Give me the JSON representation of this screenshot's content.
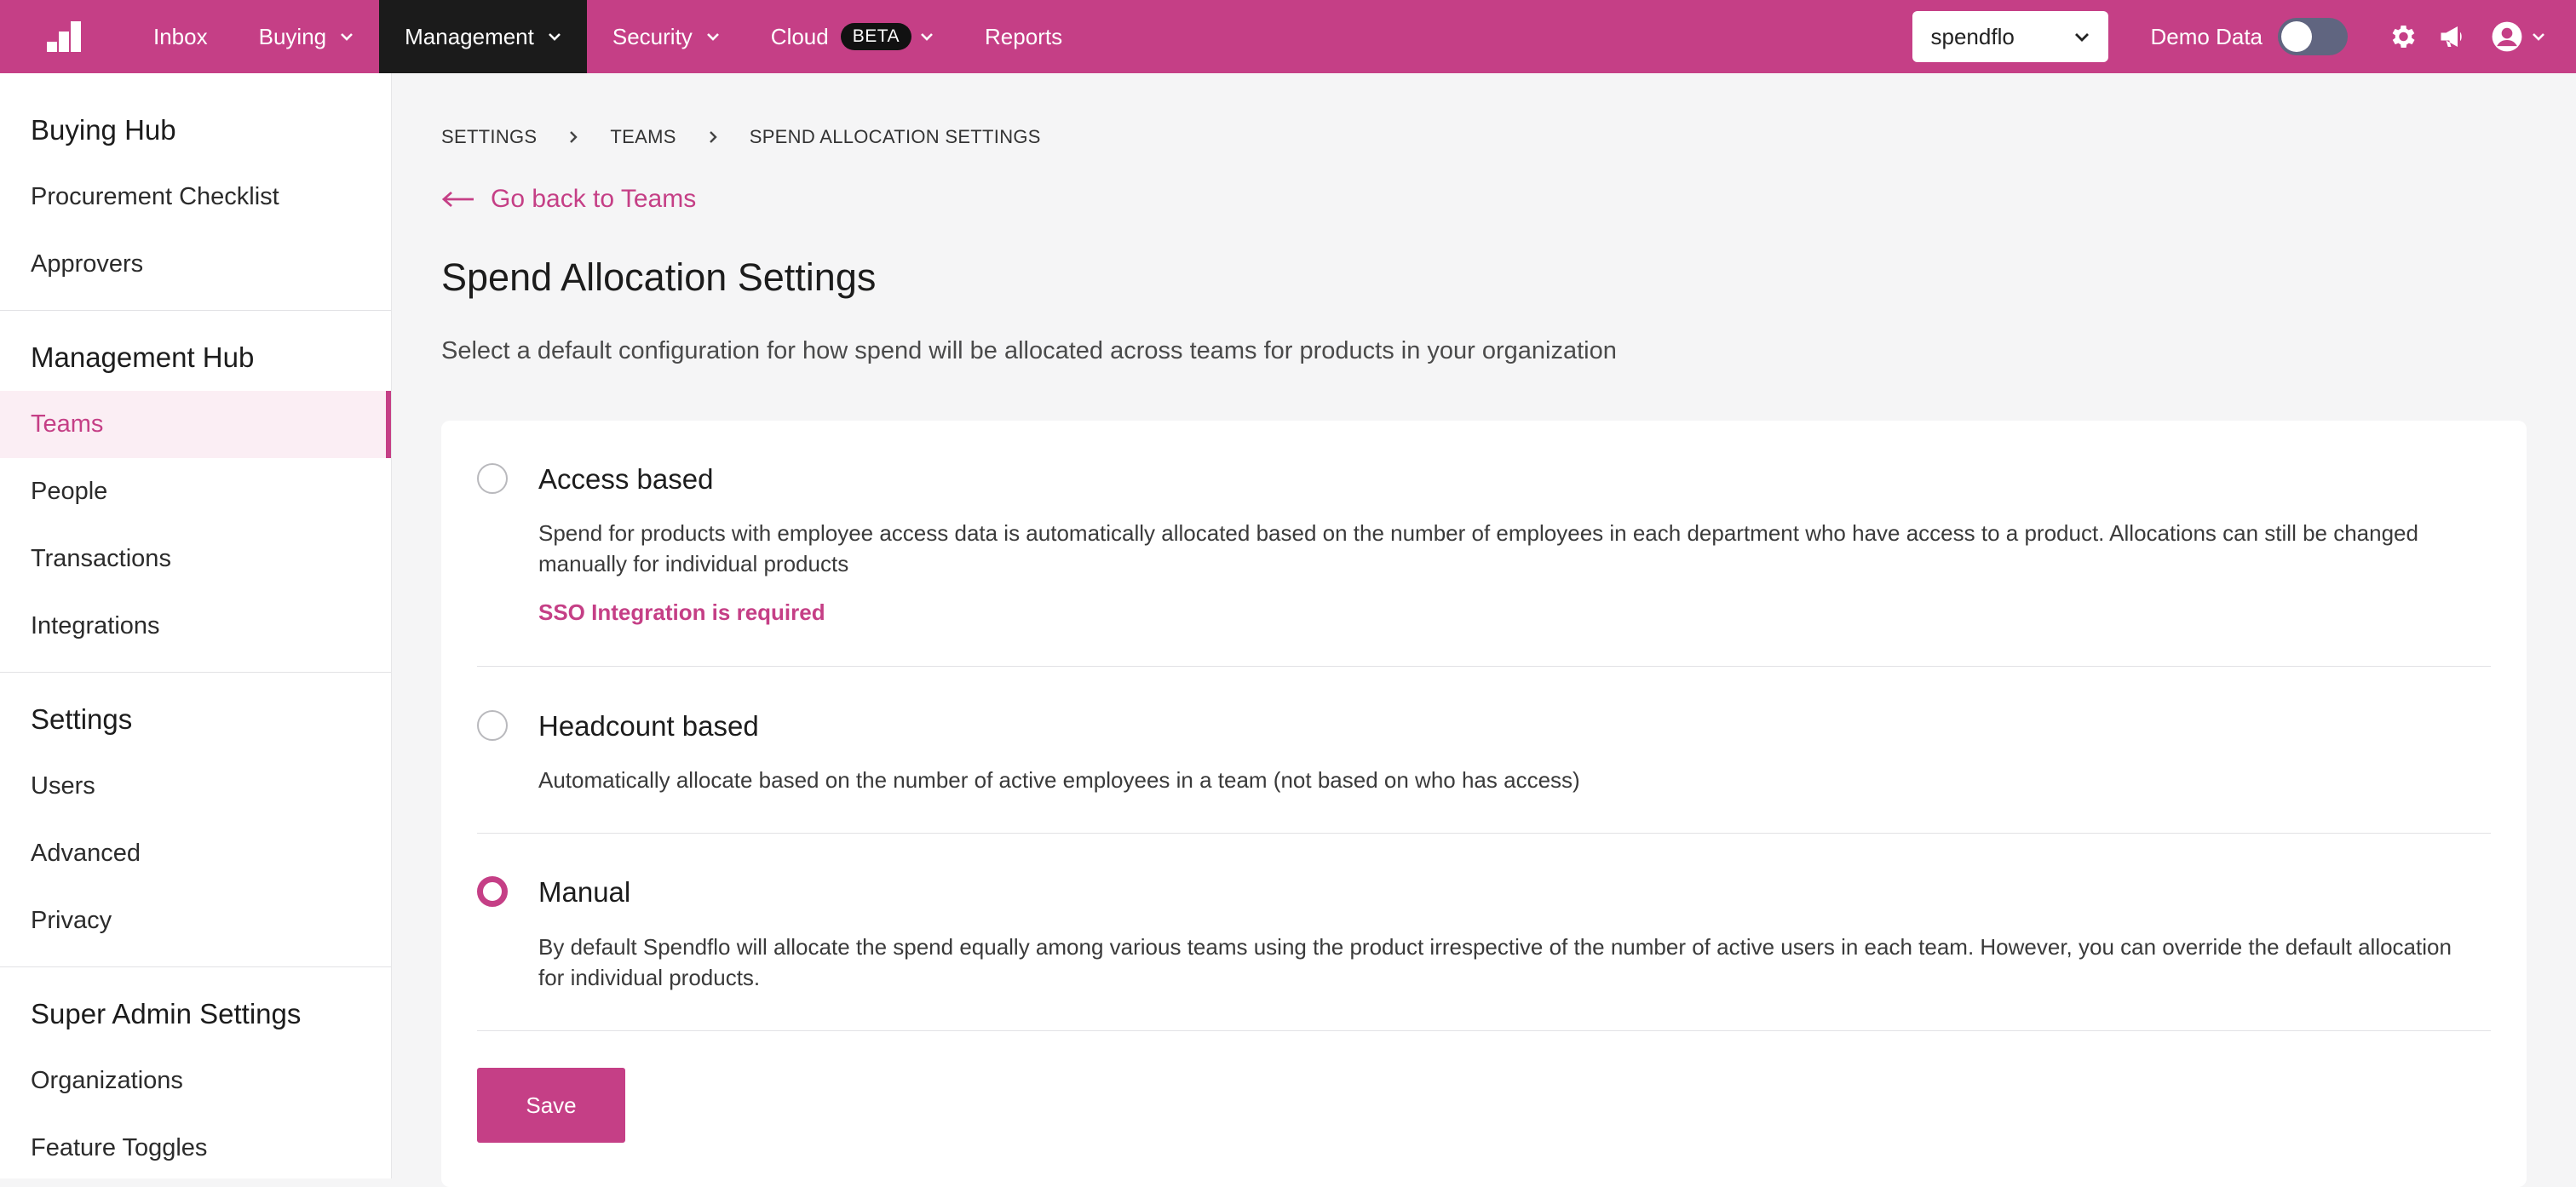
{
  "topnav": {
    "items": [
      {
        "label": "Inbox"
      },
      {
        "label": "Buying"
      },
      {
        "label": "Management"
      },
      {
        "label": "Security"
      },
      {
        "label": "Cloud"
      },
      {
        "label": "Reports"
      }
    ],
    "beta_badge": "BETA",
    "org_select_value": "spendflo",
    "demo_data_label": "Demo Data",
    "demo_data_enabled": false
  },
  "sidebar": {
    "buying_hub": {
      "title": "Buying Hub",
      "items": [
        "Procurement Checklist",
        "Approvers"
      ]
    },
    "management_hub": {
      "title": "Management Hub",
      "items": [
        "Teams",
        "People",
        "Transactions",
        "Integrations"
      ],
      "active": "Teams"
    },
    "settings": {
      "title": "Settings",
      "items": [
        "Users",
        "Advanced",
        "Privacy"
      ]
    },
    "super_admin": {
      "title": "Super Admin Settings",
      "items": [
        "Organizations",
        "Feature Toggles"
      ]
    }
  },
  "breadcrumb": [
    "SETTINGS",
    "TEAMS",
    "SPEND ALLOCATION SETTINGS"
  ],
  "back_link": "Go back to Teams",
  "page": {
    "title": "Spend Allocation Settings",
    "subtitle": "Select a default configuration for how spend will be allocated across teams for products in your organization"
  },
  "options": [
    {
      "title": "Access based",
      "description": "Spend for products with employee access data is automatically allocated based on the number of employees in each department who have access to a product. Allocations can still be changed manually for individual products",
      "requirement": "SSO Integration is required",
      "selected": false
    },
    {
      "title": "Headcount based",
      "description": "Automatically allocate based on the number of active employees in a team (not based on who has access)",
      "selected": false
    },
    {
      "title": "Manual",
      "description": "By default Spendflo will allocate the spend equally among various teams using the product irrespective of the number of active users in each team. However, you can override the default allocation for individual products.",
      "selected": true
    }
  ],
  "save_label": "Save",
  "colors": {
    "brand": "#c53f86",
    "nav_active": "#1b1b1b",
    "toggle_off": "#606580"
  }
}
